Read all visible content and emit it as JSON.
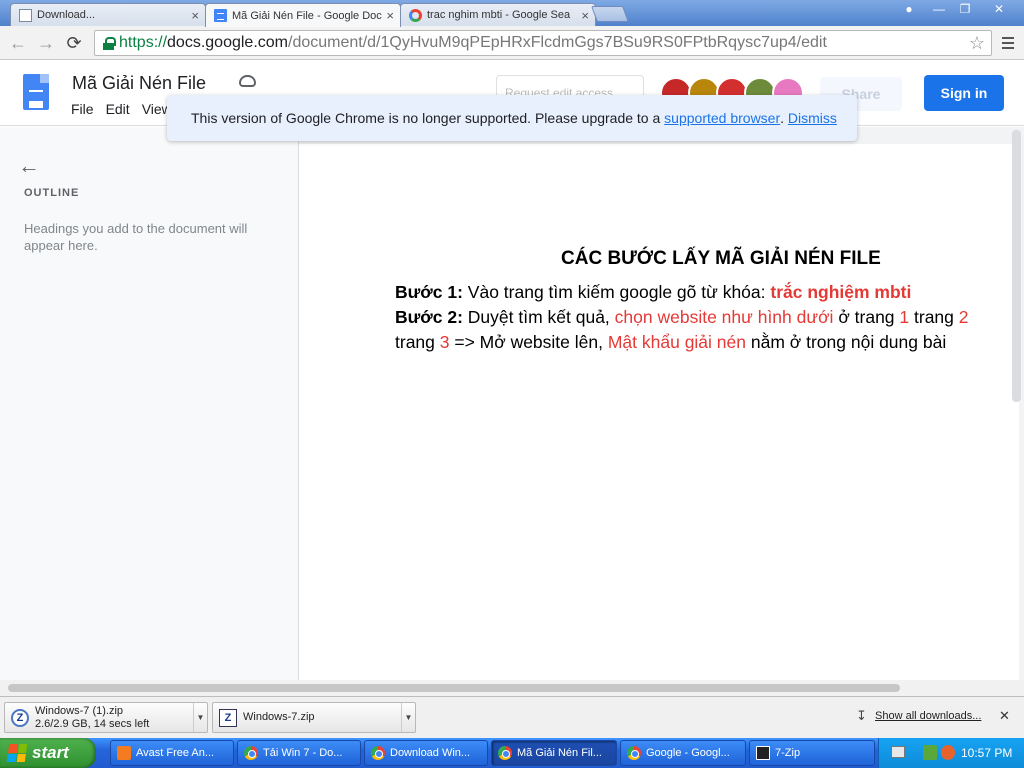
{
  "tabs": [
    {
      "title": "Download...",
      "close": "×"
    },
    {
      "title": "Mã Giải Nén File - Google Doc",
      "close": "×"
    },
    {
      "title": "trac nghim mbti - Google Sea",
      "close": "×"
    }
  ],
  "address_bar": {
    "scheme": "https://",
    "host": "docs.google.com",
    "path": "/document/d/1QyHvuM9qPEpHRxFlcdmGgs7BSu9RS0FPtbRqysc7up4/edit"
  },
  "docs": {
    "title": "Mã Giải Nén File",
    "menu": [
      "File",
      "Edit",
      "View"
    ],
    "edit_access_placeholder": "Request edit access",
    "share_label": "Share",
    "signin_label": "Sign in",
    "avatar_colors": [
      "#c62828",
      "#b8860b",
      "#d32f2f",
      "#6d8b3a",
      "#e879c0"
    ]
  },
  "banner": {
    "text": "This version of Google Chrome is no longer supported. Please upgrade to a ",
    "link": "supported browser",
    "after_link": ". ",
    "dismiss": "Dismiss"
  },
  "outline": {
    "heading": "OUTLINE",
    "empty_text": "Headings you add to the document will appear here."
  },
  "document": {
    "heading": "CÁC BƯỚC LẤY MÃ GIẢI NÉN FILE",
    "line1": {
      "label": "Bước 1:",
      "text": " Vào trang tìm kiếm google gõ từ khóa: ",
      "keyword": "trắc nghiệm mbti"
    },
    "line2": {
      "label": "Bước 2:",
      "text": " Duyệt tìm kết quả, ",
      "highlight": "chọn website như hình dưới",
      "mid": " ở trang ",
      "page1": "1",
      "trang": " trang ",
      "page2": "2"
    },
    "line3": {
      "prefix": "trang ",
      "page3": "3",
      "mid": " => Mở website lên, ",
      "highlight": "Mật khẩu giải nén",
      "suffix": " nằm ở trong nội dung bài"
    }
  },
  "downloads": [
    {
      "name": "Windows-7 (1).zip",
      "status": "2.6/2.9 GB, 14 secs left"
    },
    {
      "name": "Windows-7.zip",
      "status": ""
    }
  ],
  "downloads_show_all": "Show all downloads...",
  "taskbar": {
    "start_label": "start",
    "tasks": [
      {
        "label": "Avast Free An...",
        "icon": "avast-icon"
      },
      {
        "label": "Tải Win 7 - Do...",
        "icon": "chrome-icon"
      },
      {
        "label": "Download Win...",
        "icon": "chrome-icon"
      },
      {
        "label": "Mã Giải Nén Fil...",
        "icon": "chrome-icon"
      },
      {
        "label": "Google - Googl...",
        "icon": "chrome-icon"
      },
      {
        "label": "7-Zip",
        "icon": "7zip-icon"
      }
    ],
    "clock": "10:57 PM"
  }
}
